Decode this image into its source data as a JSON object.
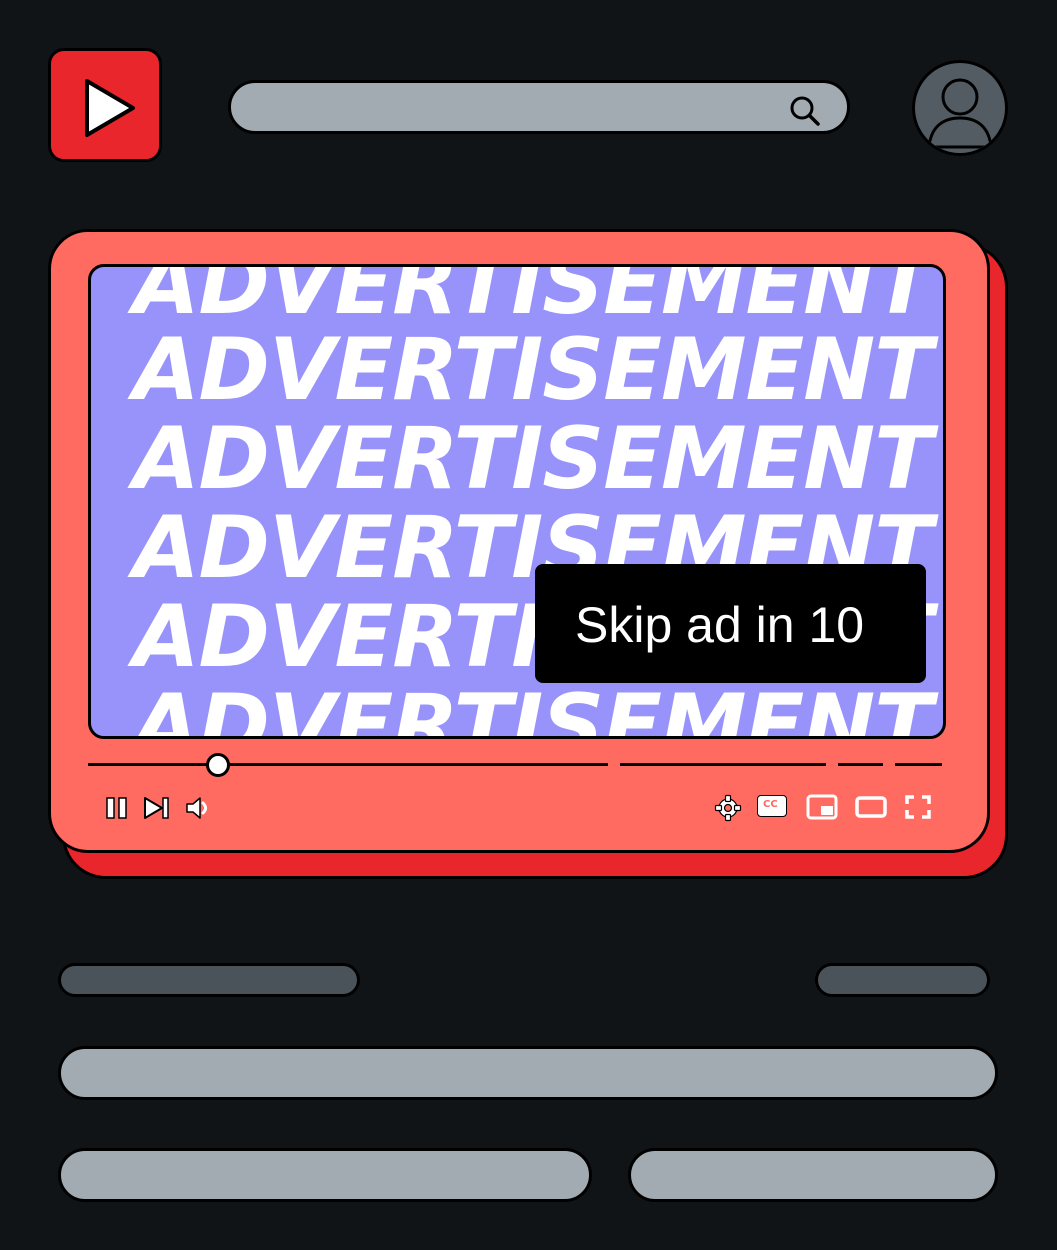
{
  "header": {
    "logo_icon": "play-icon",
    "search": {
      "placeholder": "",
      "icon": "search-icon"
    },
    "avatar_icon": "user-icon"
  },
  "player": {
    "ad_text_lines": [
      "ADVERTISEMENT",
      "ADVERTISEMENT",
      "ADVERTISEMENT",
      "ADVERTISEMENT",
      "ADVERTISEMENT",
      "ADVERTISEMENT"
    ],
    "skip_label": "Skip ad in",
    "skip_countdown": "10",
    "progress_fraction": 0.15,
    "controls_left": [
      "pause-icon",
      "next-icon",
      "volume-icon"
    ],
    "controls_right": [
      "settings-icon",
      "captions-icon",
      "miniplayer-icon",
      "theater-icon",
      "fullscreen-icon"
    ],
    "captions_text": "CC"
  },
  "colors": {
    "background": "#111417",
    "brand_red": "#e8262b",
    "player_coral": "#ff6b61",
    "ad_purple": "#9893fb",
    "placeholder_gray": "#a2abb2",
    "placeholder_dark": "#4a5359"
  }
}
